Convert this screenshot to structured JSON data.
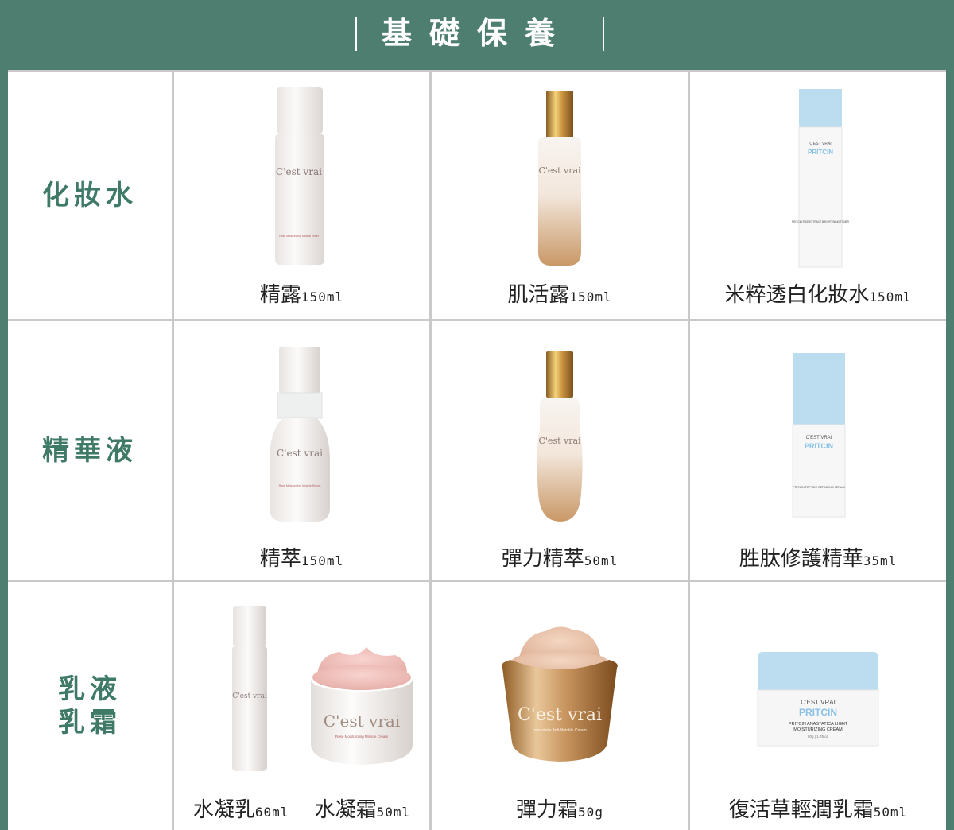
{
  "header": {
    "title": "基礎保養"
  },
  "rows": [
    {
      "label": "化妝水"
    },
    {
      "label": "精華液"
    },
    {
      "label": "乳液\n乳霜"
    }
  ],
  "products": {
    "toner": {
      "name": "精露",
      "size": "150ml"
    },
    "essence_toner": {
      "name": "肌活露",
      "size": "150ml"
    },
    "rice_toner": {
      "name": "米粹透白化妝水",
      "size": "150ml"
    },
    "serum": {
      "name": "精萃",
      "size": "150ml"
    },
    "firm_serum": {
      "name": "彈力精萃",
      "size": "50ml"
    },
    "peptide_serum": {
      "name": "胜肽修護精華",
      "size": "35ml"
    },
    "lotion": {
      "name": "水凝乳",
      "size": "60ml"
    },
    "gel_cream": {
      "name": "水凝霜",
      "size": "50ml"
    },
    "firm_cream": {
      "name": "彈力霜",
      "size": "50g"
    },
    "anastatica": {
      "name": "復活草輕潤乳霜",
      "size": "50ml"
    }
  },
  "labels": {
    "cestvrai": "C'est vrai",
    "pritcin_brand": "C'EST VRAI",
    "pritcin": "PRITCIN",
    "toner_line": "Rose Moisturizing Miracle Toner",
    "rice_line": "PRITCIN RICE EXTRACT BRIGHTENING TONER",
    "serum_line": "Rose Moisturizing Miracle Serum",
    "peptide_line": "PRITCIN PEPTIDE REPAIRING SERUM",
    "gel_line": "Rose Moisturizing Miracle Cream",
    "firm_line": "Immortelle Anti-Wrinkle Cream",
    "anastatica_line1": "PRITCIN ANASTATICA LIGHT",
    "anastatica_line2": "MOISTURIZING CREAM",
    "anastatica_size": "50g | 1.76 oz"
  },
  "colors": {
    "header_bg": "#4e7e70",
    "label_text": "#3f7a67",
    "gold": "#c89a55",
    "pritcin_blue": "#bcdcef"
  }
}
